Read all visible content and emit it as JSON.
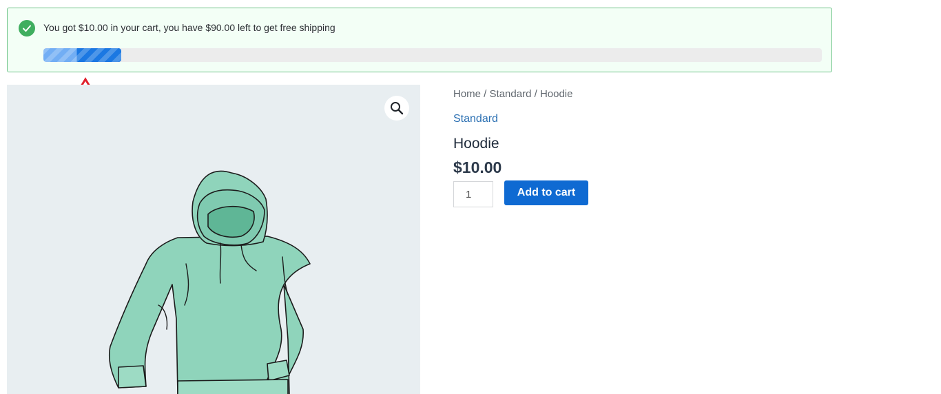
{
  "notice": {
    "message": "You got $10.00 in your cart, you have $90.00 left to get free shipping",
    "progress_percent": 10
  },
  "colors": {
    "notice_border": "#6cc287",
    "check": "#3fae5f",
    "progress_fill": "#1b78e2",
    "annotation_arrow": "#e0202b",
    "accent_button": "#0f6ad2"
  },
  "product": {
    "breadcrumb": [
      "Home",
      "Standard",
      "Hoodie"
    ],
    "breadcrumb_separator": " / ",
    "category": "Standard",
    "title": "Hoodie",
    "price": "$10.00",
    "quantity": "1",
    "add_to_cart_label": "Add to cart"
  },
  "icons": {
    "notice": "checkmark-icon",
    "gallery_zoom": "magnifier-icon"
  }
}
